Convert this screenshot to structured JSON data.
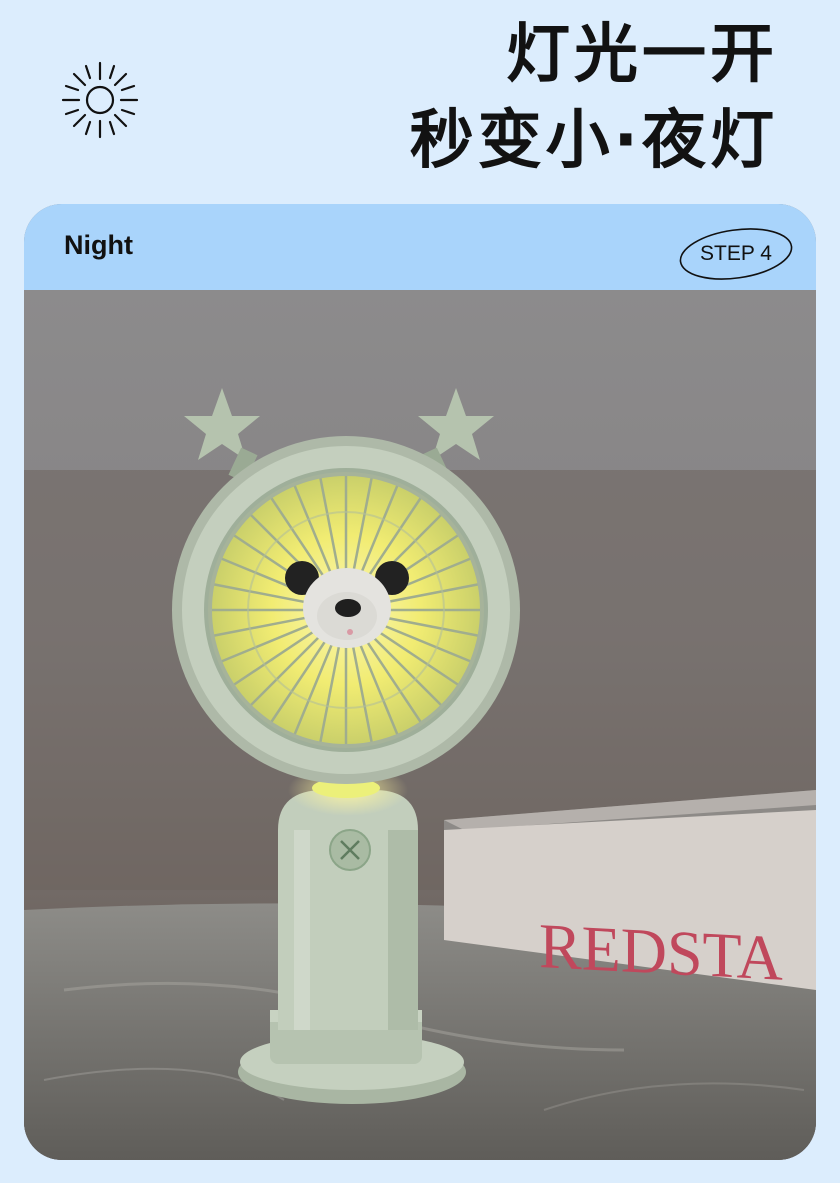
{
  "header": {
    "icon": "sun-icon",
    "headline_line1": "灯光一开",
    "headline_line2": "秒变小·夜灯"
  },
  "card": {
    "title": "Night",
    "step_badge": "STEP 4",
    "photo": {
      "subject": "handheld fan with bear face and star ears, night light glowing",
      "book_spine_text": "REDSTA"
    }
  },
  "colors": {
    "page_background": "#dcedfd",
    "card_header": "#a9d4fb",
    "fan_body": "#b9c7b3",
    "night_glow": "#f1ec72"
  }
}
